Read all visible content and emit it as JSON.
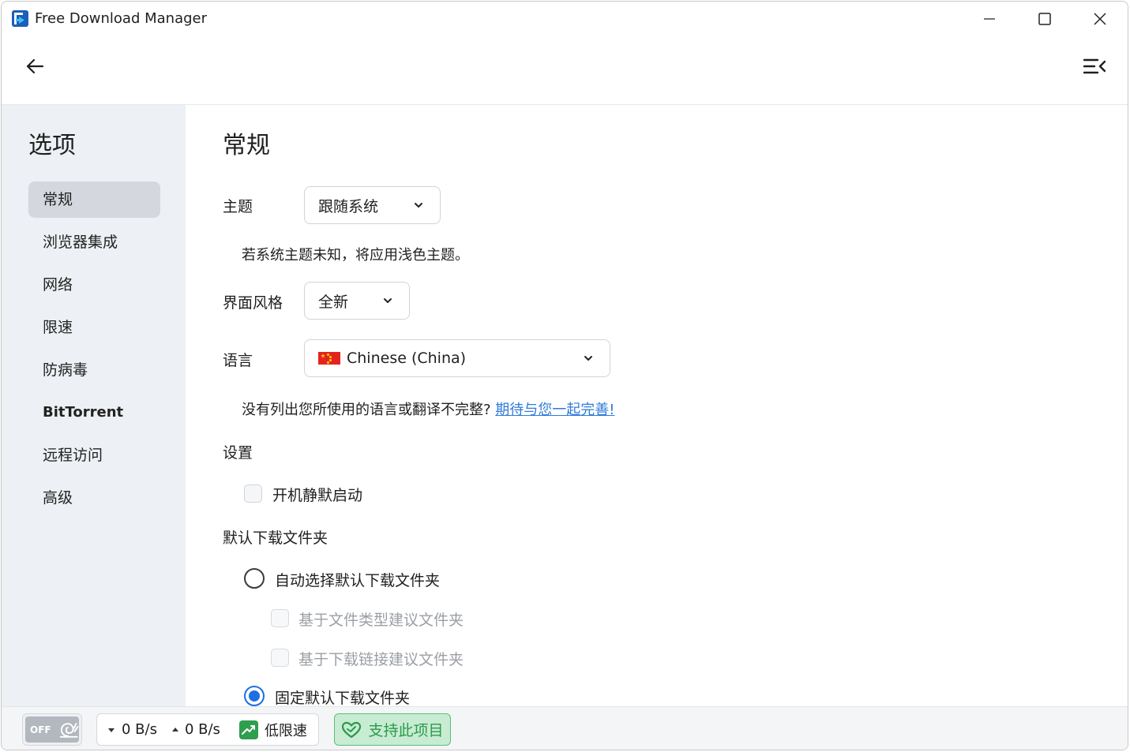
{
  "window": {
    "title": "Free Download Manager"
  },
  "sidebar": {
    "title": "选项",
    "items": [
      {
        "label": "常规",
        "active": true
      },
      {
        "label": "浏览器集成"
      },
      {
        "label": "网络"
      },
      {
        "label": "限速"
      },
      {
        "label": "防病毒"
      },
      {
        "label": "BitTorrent"
      },
      {
        "label": "远程访问"
      },
      {
        "label": "高级"
      }
    ]
  },
  "main": {
    "title": "常规",
    "theme": {
      "label": "主题",
      "value": "跟随系统",
      "hint": "若系统主题未知，将应用浅色主题。"
    },
    "style": {
      "label": "界面风格",
      "value": "全新"
    },
    "language": {
      "label": "语言",
      "value": "Chinese (China)",
      "hint": "没有列出您所使用的语言或翻译不完整?",
      "link": "期待与您一起完善!"
    },
    "settings": {
      "label": "设置",
      "silent_start": "开机静默启动"
    },
    "default_folder": {
      "label": "默认下载文件夹",
      "auto_option": "自动选择默认下载文件夹",
      "by_type": "基于文件类型建议文件夹",
      "by_link": "基于下载链接建议文件夹",
      "fixed_option": "固定默认下载文件夹",
      "selected": "fixed"
    }
  },
  "statusbar": {
    "toggle_text": "OFF",
    "download_speed": "0 B/s",
    "upload_speed": "0 B/s",
    "speed_mode": "低限速",
    "support": "支持此项目",
    "colors": {
      "support_green": "#2a9a4c",
      "mode_green": "#2e9e4f"
    }
  }
}
